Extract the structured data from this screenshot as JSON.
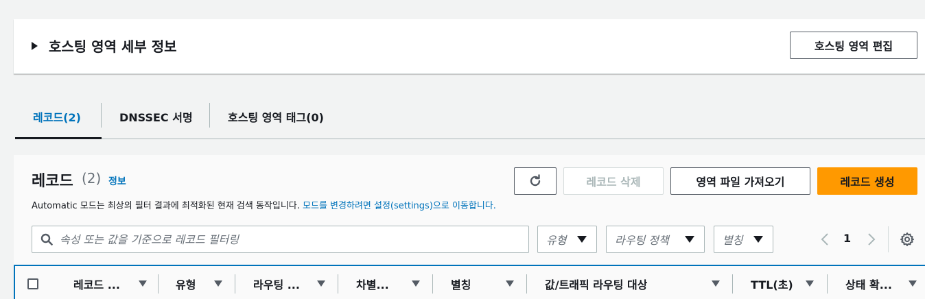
{
  "details": {
    "title": "호스팅 영역 세부 정보",
    "edit_button": "호스팅 영역 편집"
  },
  "tabs": [
    {
      "label": "레코드(2)",
      "active": true
    },
    {
      "label": "DNSSEC 서명",
      "active": false
    },
    {
      "label": "호스팅 영역 태그(0)",
      "active": false
    }
  ],
  "records": {
    "title": "레코드",
    "count": "(2)",
    "info_link": "정보",
    "description_prefix": "Automatic 모드는 최상의 필터 결과에 최적화된 현재 검색 동작입니다. ",
    "description_link": "모드를 변경하려면 설정(settings)으로 이동합니다.",
    "buttons": {
      "delete": "레코드 삭제",
      "import": "영역 파일 가져오기",
      "create": "레코드 생성"
    },
    "search_placeholder": "속성 또는 값을 기준으로 레코드 필터링",
    "filters": [
      "유형",
      "라우팅 정책",
      "별칭"
    ],
    "page_number": "1",
    "columns": [
      "레코드 ...",
      "유형",
      "라우팅 ...",
      "차별...",
      "별칭",
      "값/트래픽 라우팅 대상",
      "TTL(초)",
      "상태 확..."
    ]
  },
  "colors": {
    "accent": "#0073bb",
    "primary_button": "#ff9900",
    "text": "#16191f",
    "muted": "#687078"
  },
  "icons": {
    "caret": "caret-right-icon",
    "refresh": "refresh-icon",
    "search": "search-icon",
    "dropdown": "triangle-down-icon",
    "prev": "chevron-left-icon",
    "next": "chevron-right-icon",
    "settings": "gear-icon",
    "sort": "sort-down-icon"
  }
}
